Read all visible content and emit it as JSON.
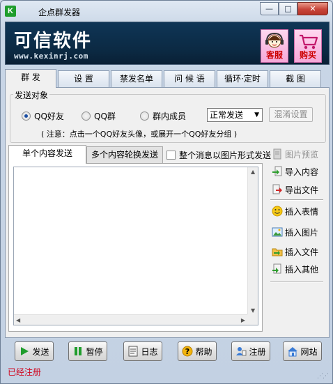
{
  "window": {
    "title": "企点群发器",
    "app_icon_letter": "K",
    "minimize_glyph": "—",
    "maximize_glyph": "□",
    "close_glyph": "✕"
  },
  "banner": {
    "brand_name": "可信软件",
    "url": "www.kexinrj.com",
    "service_label": "客服",
    "buy_label": "购买"
  },
  "tabs": [
    {
      "label": "群 发",
      "active": true
    },
    {
      "label": "设 置",
      "active": false
    },
    {
      "label": "禁发名单",
      "active": false
    },
    {
      "label": "问 候 语",
      "active": false
    },
    {
      "label": "循环·定时",
      "active": false
    },
    {
      "label": "截 图",
      "active": false
    }
  ],
  "send_target": {
    "legend": "发送对象",
    "options": [
      {
        "label": "QQ好友",
        "selected": true
      },
      {
        "label": "QQ群",
        "selected": false
      },
      {
        "label": "群内成员",
        "selected": false
      }
    ],
    "mode_selected": "正常发送",
    "mix_settings_label": "混淆设置",
    "notice": "( 注意：点击一个QQ好友头像，或展开一个QQ好友分组 )"
  },
  "content": {
    "tab_single": "单个内容发送",
    "tab_multi": "多个内容轮换发送",
    "image_mode_label": "整个消息以图片形式发送",
    "image_mode_checked": false,
    "editor_value": ""
  },
  "side_actions": {
    "preview": "图片预览",
    "import": "导入内容",
    "export": "导出文件",
    "insert_emoji": "插入表情",
    "insert_image": "插入图片",
    "insert_file": "插入文件",
    "insert_other": "插入其他"
  },
  "bottom_buttons": {
    "send": "发送",
    "pause": "暂停",
    "log": "日志",
    "help": "帮助",
    "register": "注册",
    "website": "网站"
  },
  "status": {
    "text": "已经注册",
    "color": "#d0021b"
  },
  "colors": {
    "banner_bg": "#0b2942",
    "promo_bg": "#f5a8d8",
    "close_red": "#c7453a"
  }
}
